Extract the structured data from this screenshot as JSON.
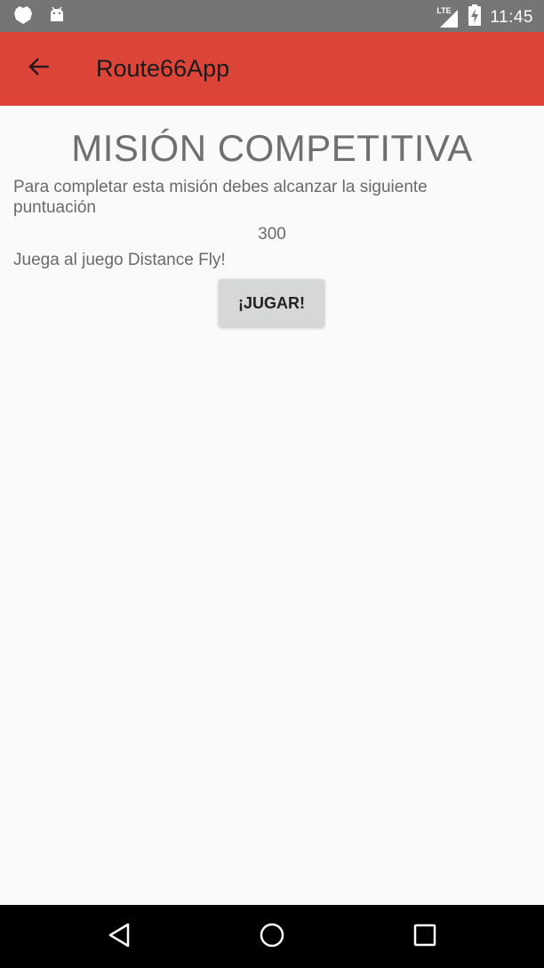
{
  "status_bar": {
    "time": "11:45",
    "network_label": "LTE",
    "left_icons": [
      "notification-shield-icon",
      "android-notification-icon"
    ],
    "right_icons": [
      "signal-icon",
      "battery-charging-icon"
    ]
  },
  "app_bar": {
    "title": "Route66App",
    "back_icon": "arrow-back-icon",
    "color": "#dd4438"
  },
  "mission": {
    "title": "MISIÓN COMPETITIVA",
    "instructions": "Para completar esta misión debes alcanzar la siguiente puntuación",
    "score": "300",
    "game_hint": "Juega al juego Distance Fly!",
    "play_label": "¡JUGAR!"
  },
  "nav_bar": {
    "buttons": [
      "back-triangle-icon",
      "home-circle-icon",
      "recents-square-icon"
    ]
  }
}
